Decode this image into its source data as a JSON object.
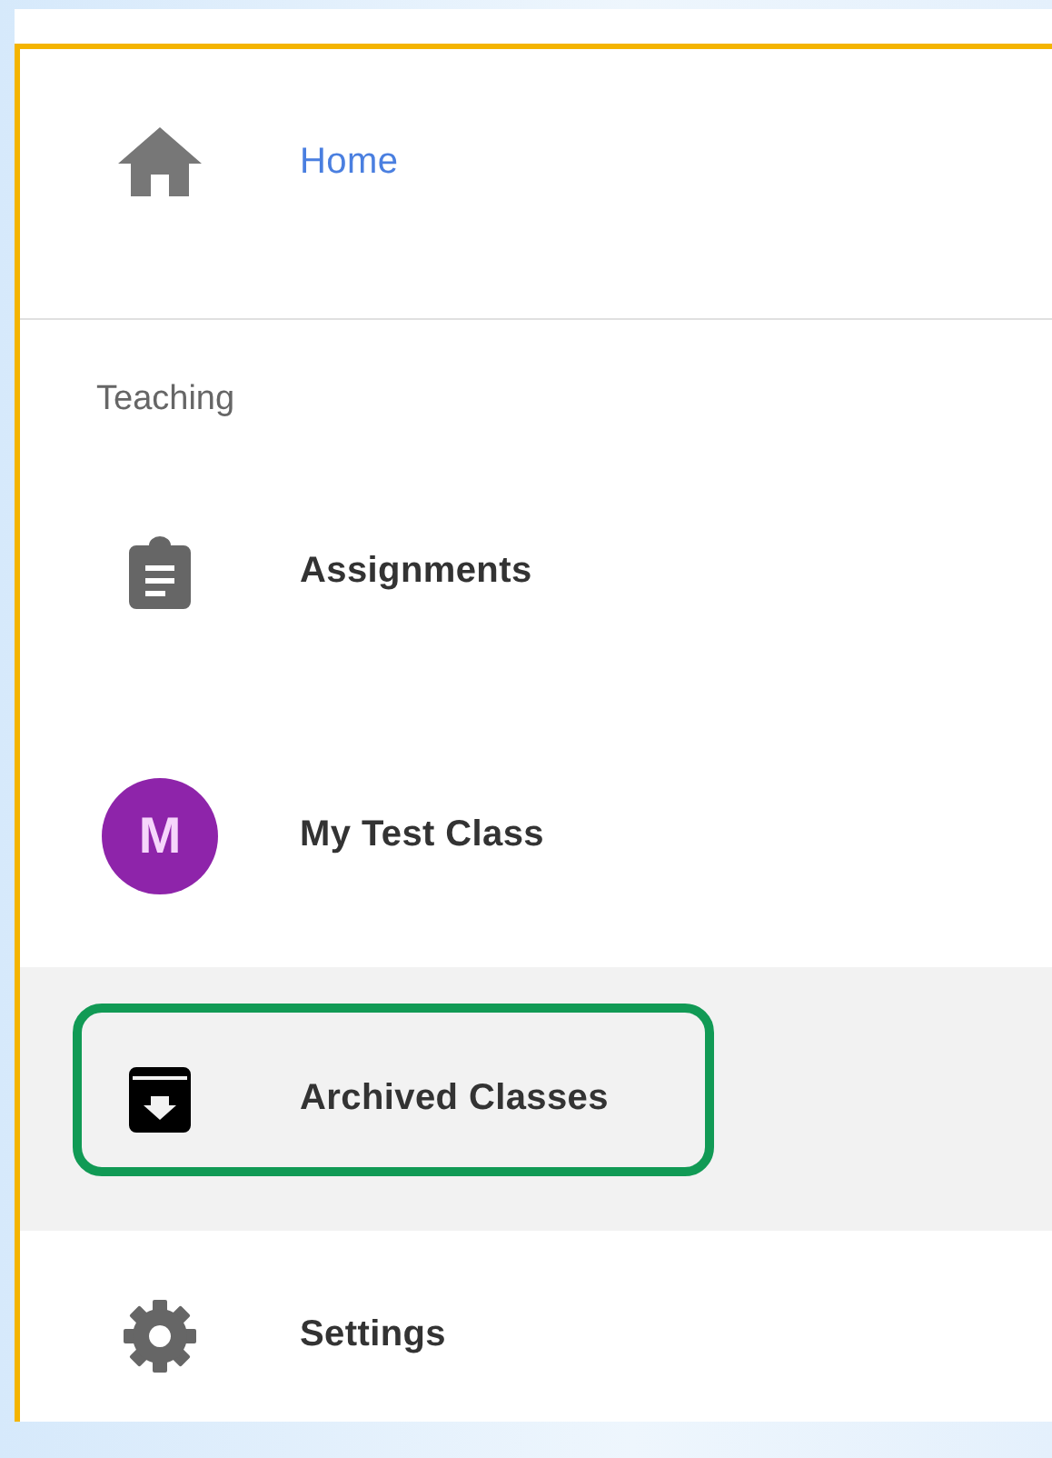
{
  "home": {
    "label": "Home",
    "kind": "home",
    "selected": true
  },
  "section": {
    "label": "Teaching"
  },
  "items": [
    {
      "label": "Assignments",
      "kind": "assignments",
      "highlighted": false,
      "annotated": false
    },
    {
      "label": "My Test Class",
      "kind": "class",
      "avatar": "M",
      "color": "#8e24aa",
      "highlighted": false,
      "annotated": false
    },
    {
      "label": "Archived Classes",
      "kind": "archive",
      "highlighted": true,
      "annotated": true
    },
    {
      "label": "Settings",
      "kind": "settings",
      "highlighted": false,
      "annotated": false
    }
  ]
}
